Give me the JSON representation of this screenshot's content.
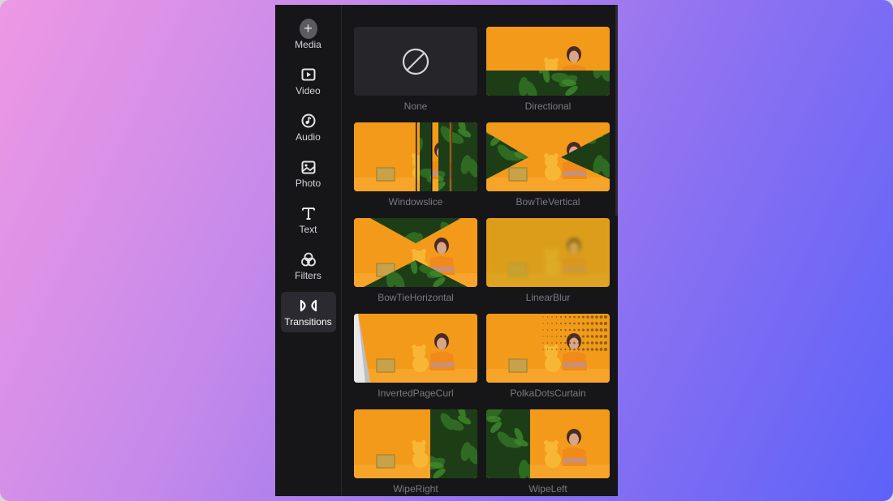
{
  "sidebar": {
    "items": [
      {
        "label": "Media",
        "icon": "plus-circle-icon",
        "active": false
      },
      {
        "label": "Video",
        "icon": "video-play-icon",
        "active": false
      },
      {
        "label": "Audio",
        "icon": "music-note-icon",
        "active": false
      },
      {
        "label": "Photo",
        "icon": "image-icon",
        "active": false
      },
      {
        "label": "Text",
        "icon": "text-t-icon",
        "active": false
      },
      {
        "label": "Filters",
        "icon": "filters-circles-icon",
        "active": false
      },
      {
        "label": "Transitions",
        "icon": "bowtie-transition-icon",
        "active": true
      }
    ]
  },
  "transitions": {
    "items": [
      {
        "label": "None",
        "effect": "none"
      },
      {
        "label": "Directional",
        "effect": "directional"
      },
      {
        "label": "Windowslice",
        "effect": "windowslice"
      },
      {
        "label": "BowTieVertical",
        "effect": "bowtie-vertical"
      },
      {
        "label": "BowTieHorizontal",
        "effect": "bowtie-horizontal"
      },
      {
        "label": "LinearBlur",
        "effect": "linear-blur"
      },
      {
        "label": "InvertedPageCurl",
        "effect": "inverted-page-curl"
      },
      {
        "label": "PolkaDotsCurtain",
        "effect": "polka-dots-curtain"
      },
      {
        "label": "WipeRight",
        "effect": "wipe-right"
      },
      {
        "label": "WipeLeft",
        "effect": "wipe-left"
      }
    ]
  },
  "colors": {
    "scene_orange": "#f39a1a",
    "leaf_green": "#2f6a22",
    "panel_bg": "#161619",
    "active_bg": "#2a2a30"
  }
}
